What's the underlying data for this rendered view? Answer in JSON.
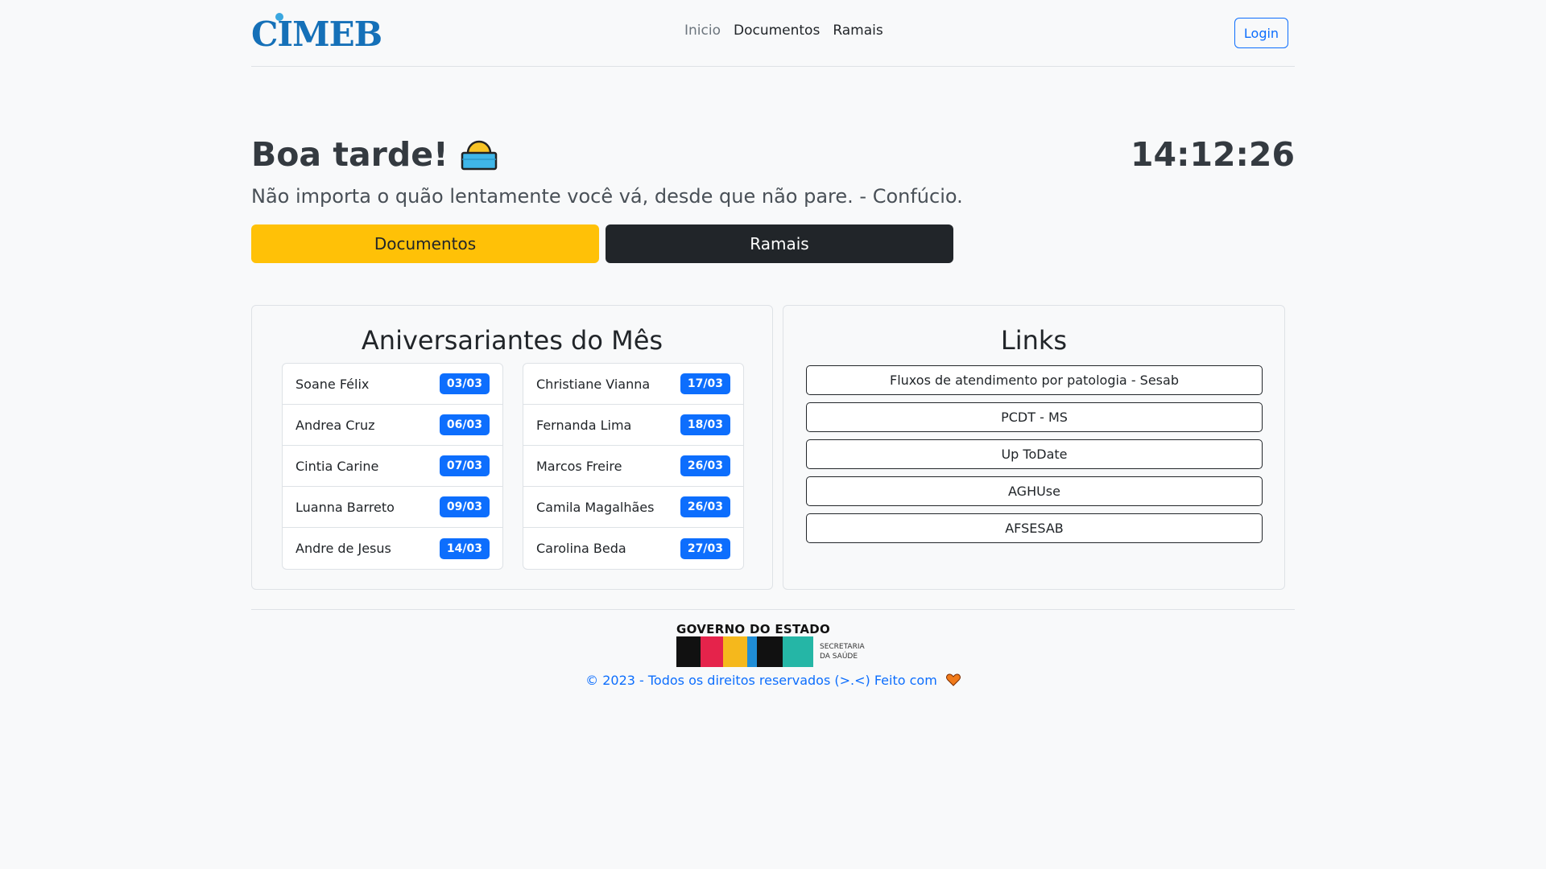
{
  "navbar": {
    "logo": "CIMEB",
    "links": [
      "Inicio",
      "Documentos",
      "Ramais"
    ],
    "login": "Login"
  },
  "hero": {
    "greeting": "Boa tarde!",
    "clock": "14:12:26",
    "quote": "Não importa o quão lentamente você vá, desde que não pare. - Confúcio.",
    "buttons": [
      "Documentos",
      "Ramais"
    ]
  },
  "birthdays": {
    "title": "Aniversariantes do Mês",
    "left": [
      {
        "name": "Soane Félix",
        "date": "03/03"
      },
      {
        "name": "Andrea Cruz",
        "date": "06/03"
      },
      {
        "name": "Cintia Carine",
        "date": "07/03"
      },
      {
        "name": "Luanna Barreto",
        "date": "09/03"
      },
      {
        "name": "Andre de Jesus",
        "date": "14/03"
      }
    ],
    "right": [
      {
        "name": "Christiane Vianna",
        "date": "17/03"
      },
      {
        "name": "Fernanda Lima",
        "date": "18/03"
      },
      {
        "name": "Marcos Freire",
        "date": "26/03"
      },
      {
        "name": "Camila Magalhães",
        "date": "26/03"
      },
      {
        "name": "Carolina Beda",
        "date": "27/03"
      }
    ]
  },
  "links": {
    "title": "Links",
    "items": [
      "Fluxos de atendimento por patologia - Sesab",
      "PCDT - MS",
      "Up ToDate",
      "AGHUse",
      "AFSESAB"
    ]
  },
  "footer": {
    "gov_top": "GOVERNO DO ESTADO",
    "gov_name": "BAHIA",
    "gov_side_1": "SECRETARIA",
    "gov_side_2": "DA SAÚDE",
    "copyright": "© 2023 - Todos os direitos reservados (>.<) Feito com"
  },
  "colors": {
    "primary": "#0d6efd",
    "warning": "#ffc107",
    "dark": "#212529",
    "logo": "#1570b8"
  }
}
